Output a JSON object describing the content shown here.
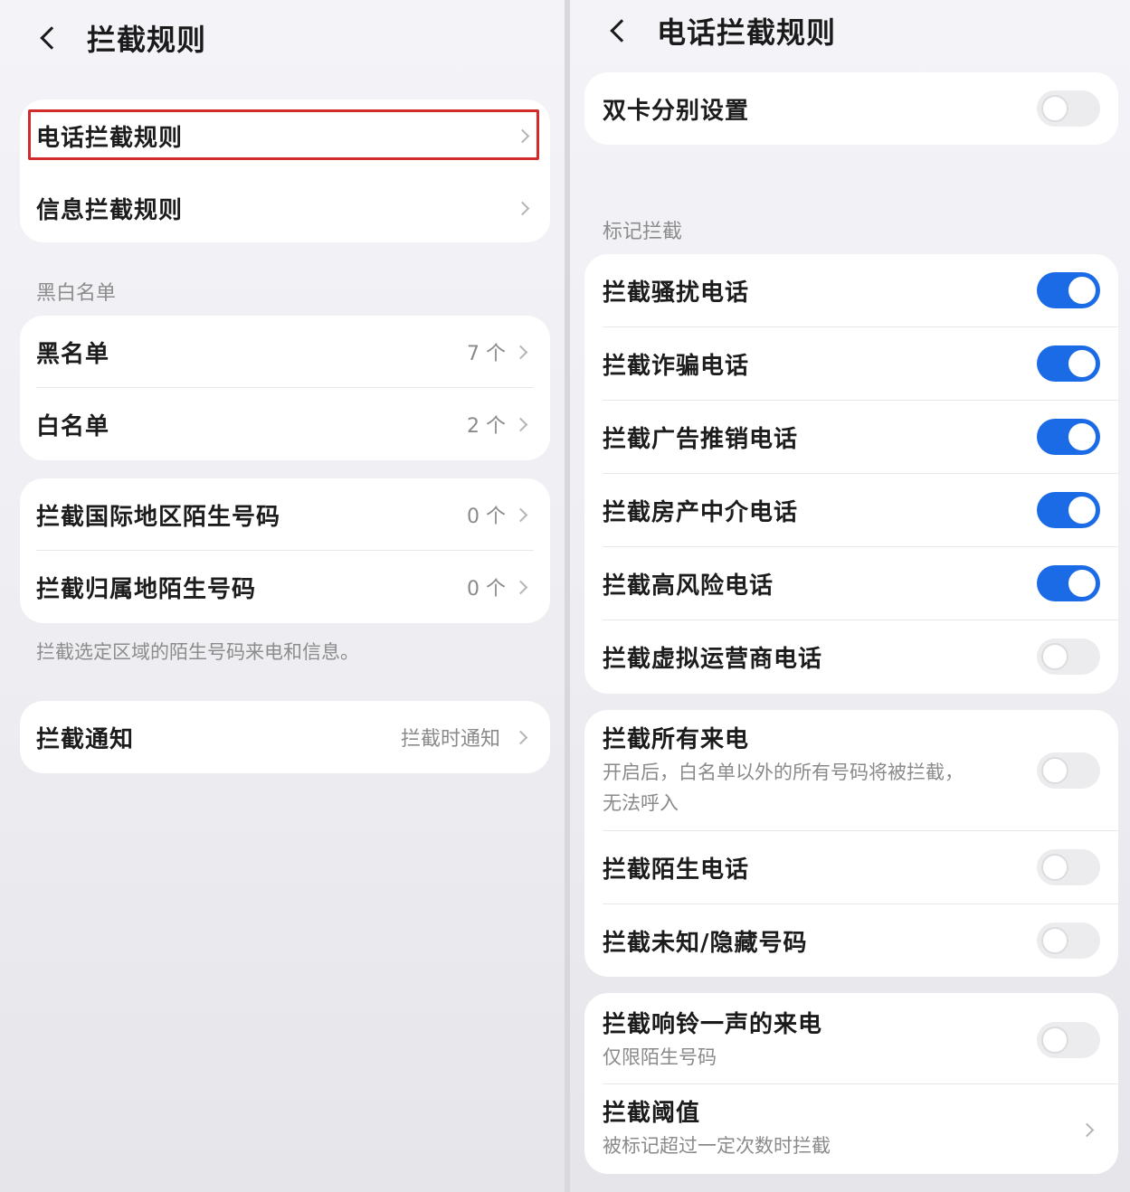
{
  "left": {
    "title": "拦截规则",
    "rules": [
      {
        "label": "电话拦截规则"
      },
      {
        "label": "信息拦截规则"
      }
    ],
    "list_section": "黑白名单",
    "lists": [
      {
        "label": "黑名单",
        "value": "7 个"
      },
      {
        "label": "白名单",
        "value": "2 个"
      }
    ],
    "region": [
      {
        "label": "拦截国际地区陌生号码",
        "value": "0 个"
      },
      {
        "label": "拦截归属地陌生号码",
        "value": "0 个"
      }
    ],
    "region_note": "拦截选定区域的陌生号码来电和信息。",
    "notify": {
      "label": "拦截通知",
      "value": "拦截时通知"
    }
  },
  "right": {
    "title": "电话拦截规则",
    "dual_sim": {
      "label": "双卡分别设置",
      "on": false
    },
    "mark_section": "标记拦截",
    "mark_items": [
      {
        "label": "拦截骚扰电话",
        "on": true
      },
      {
        "label": "拦截诈骗电话",
        "on": true
      },
      {
        "label": "拦截广告推销电话",
        "on": true
      },
      {
        "label": "拦截房产中介电话",
        "on": true
      },
      {
        "label": "拦截高风险电话",
        "on": true
      },
      {
        "label": "拦截虚拟运营商电话",
        "on": false
      }
    ],
    "all_calls": {
      "label": "拦截所有来电",
      "desc_line1": "开启后，白名单以外的所有号码将被拦截，",
      "desc_line2": "无法呼入",
      "on": false
    },
    "strangers": {
      "label": "拦截陌生电话",
      "on": false
    },
    "unknown": {
      "label": "拦截未知/隐藏号码",
      "on": false
    },
    "one_ring": {
      "label": "拦截响铃一声的来电",
      "desc": "仅限陌生号码",
      "on": false
    },
    "threshold": {
      "label": "拦截阈值",
      "desc": "被标记超过一定次数时拦截"
    }
  }
}
